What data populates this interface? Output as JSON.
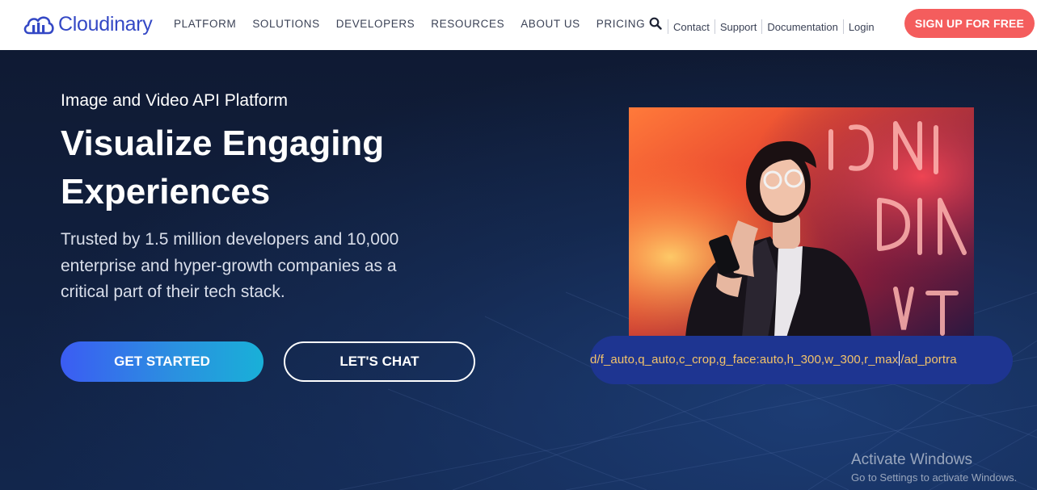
{
  "brand": {
    "name": "Cloudinary",
    "color": "#3448c5"
  },
  "nav": {
    "menu": [
      {
        "label": "PLATFORM"
      },
      {
        "label": "SOLUTIONS"
      },
      {
        "label": "DEVELOPERS"
      },
      {
        "label": "RESOURCES"
      },
      {
        "label": "ABOUT US"
      },
      {
        "label": "PRICING"
      }
    ],
    "search_icon": "search-icon",
    "utility": [
      {
        "label": "Contact"
      },
      {
        "label": "Support"
      },
      {
        "label": "Documentation"
      },
      {
        "label": "Login"
      }
    ],
    "signup_label": "SIGN UP FOR FREE",
    "signup_color": "#f45d5d"
  },
  "hero": {
    "eyebrow": "Image and Video API Platform",
    "headline": "Visualize Engaging Experiences",
    "subtext": "Trusted by 1.5 million developers and 10,000 enterprise and hyper-growth companies as a critical part of their tech stack.",
    "cta_primary": "GET STARTED",
    "cta_secondary": "LET'S CHAT",
    "url_before_cursor": "d/f_auto,q_auto,c_crop,g_face:auto,h_300,w_300,r_max",
    "url_after_cursor": "/ad_portra",
    "url_text_color": "#f3c36a",
    "url_pill_color": "#1e3591"
  },
  "watermark": {
    "title": "Activate Windows",
    "subtitle": "Go to Settings to activate Windows."
  }
}
